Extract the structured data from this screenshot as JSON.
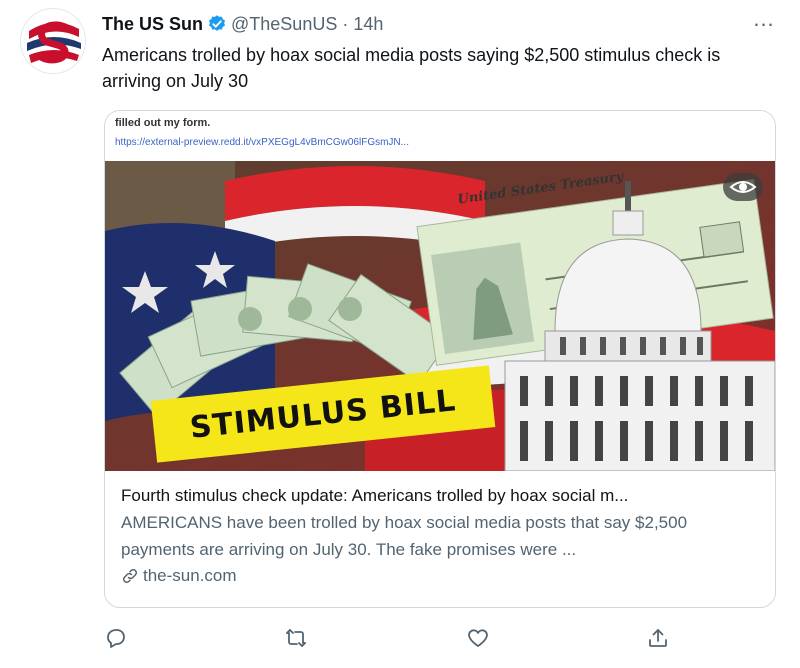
{
  "tweet": {
    "display_name": "The US Sun",
    "handle": "@TheSunUS",
    "separator": "·",
    "time": "14h",
    "text": "Americans trolled by hoax social media posts saying $2,500 stimulus check is arriving on July 30",
    "more_label": "..."
  },
  "card": {
    "reddit_text": "filled out my form.",
    "reddit_link": "https://external-preview.redd.it/vxPXEGgL4vBmCGw06lFGsmJN...",
    "banner_text": "STIMULUS BILL",
    "treasury_text": "United States Treasury",
    "title": "Fourth stimulus check update: Americans trolled by hoax social m...",
    "description": "AMERICANS have been trolled by hoax social media posts that say $2,500 payments are arriving on July 30. The fake promises were ...",
    "domain": "the-sun.com"
  },
  "actions": [
    {
      "icon": "reply-icon"
    },
    {
      "icon": "retweet-icon"
    },
    {
      "icon": "like-icon"
    },
    {
      "icon": "share-icon"
    }
  ],
  "colors": {
    "verified": "#1d9bf0",
    "secondary_text": "#536471",
    "avatar_red": "#c8102e",
    "avatar_navy": "#1f3a6e",
    "banner_yellow": "#f4e619"
  }
}
